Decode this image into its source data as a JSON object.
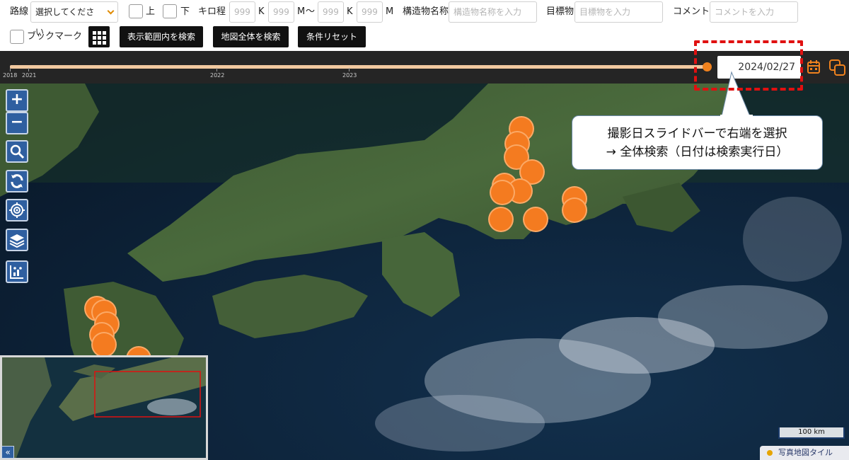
{
  "filters": {
    "route_label": "路線",
    "route_select": "選択してください",
    "up_label": "上",
    "down_label": "下",
    "kilo_label": "キロ程",
    "kilo_from_k_placeholder": "999",
    "k_unit_1": "K",
    "kilo_from_m_placeholder": "999",
    "m_unit_1": "M",
    "tilde": "～",
    "kilo_to_k_placeholder": "999",
    "k_unit_2": "K",
    "kilo_to_m_placeholder": "999",
    "m_unit_2": "M",
    "structure_label": "構造物名称",
    "structure_placeholder": "構造物名称を入力",
    "landmark_label": "目標物",
    "landmark_placeholder": "目標物を入力",
    "comment_label": "コメント",
    "comment_placeholder": "コメントを入力",
    "bookmark_label": "ブックマーク",
    "search_visible_button": "表示範囲内を検索",
    "search_all_button": "地図全体を検索",
    "reset_button": "条件リセット"
  },
  "timeline": {
    "tick_labels": [
      "2018",
      "2021",
      "2022",
      "2023"
    ],
    "selected_date": "2024/02/27",
    "slider_position_percent": 100
  },
  "callout": {
    "line1": "撮影日スライドバーで右端を選択",
    "line2": "→  全体検索（日付は検索実行日）"
  },
  "map": {
    "zoom_in": "+",
    "zoom_out": "−",
    "scale_label": "100 km",
    "tile_label": "写真地図タイル",
    "collapse_label": "«",
    "marker_color": "#f47b20",
    "highlight_color": "#e01010",
    "accent_color": "#f0821e"
  }
}
